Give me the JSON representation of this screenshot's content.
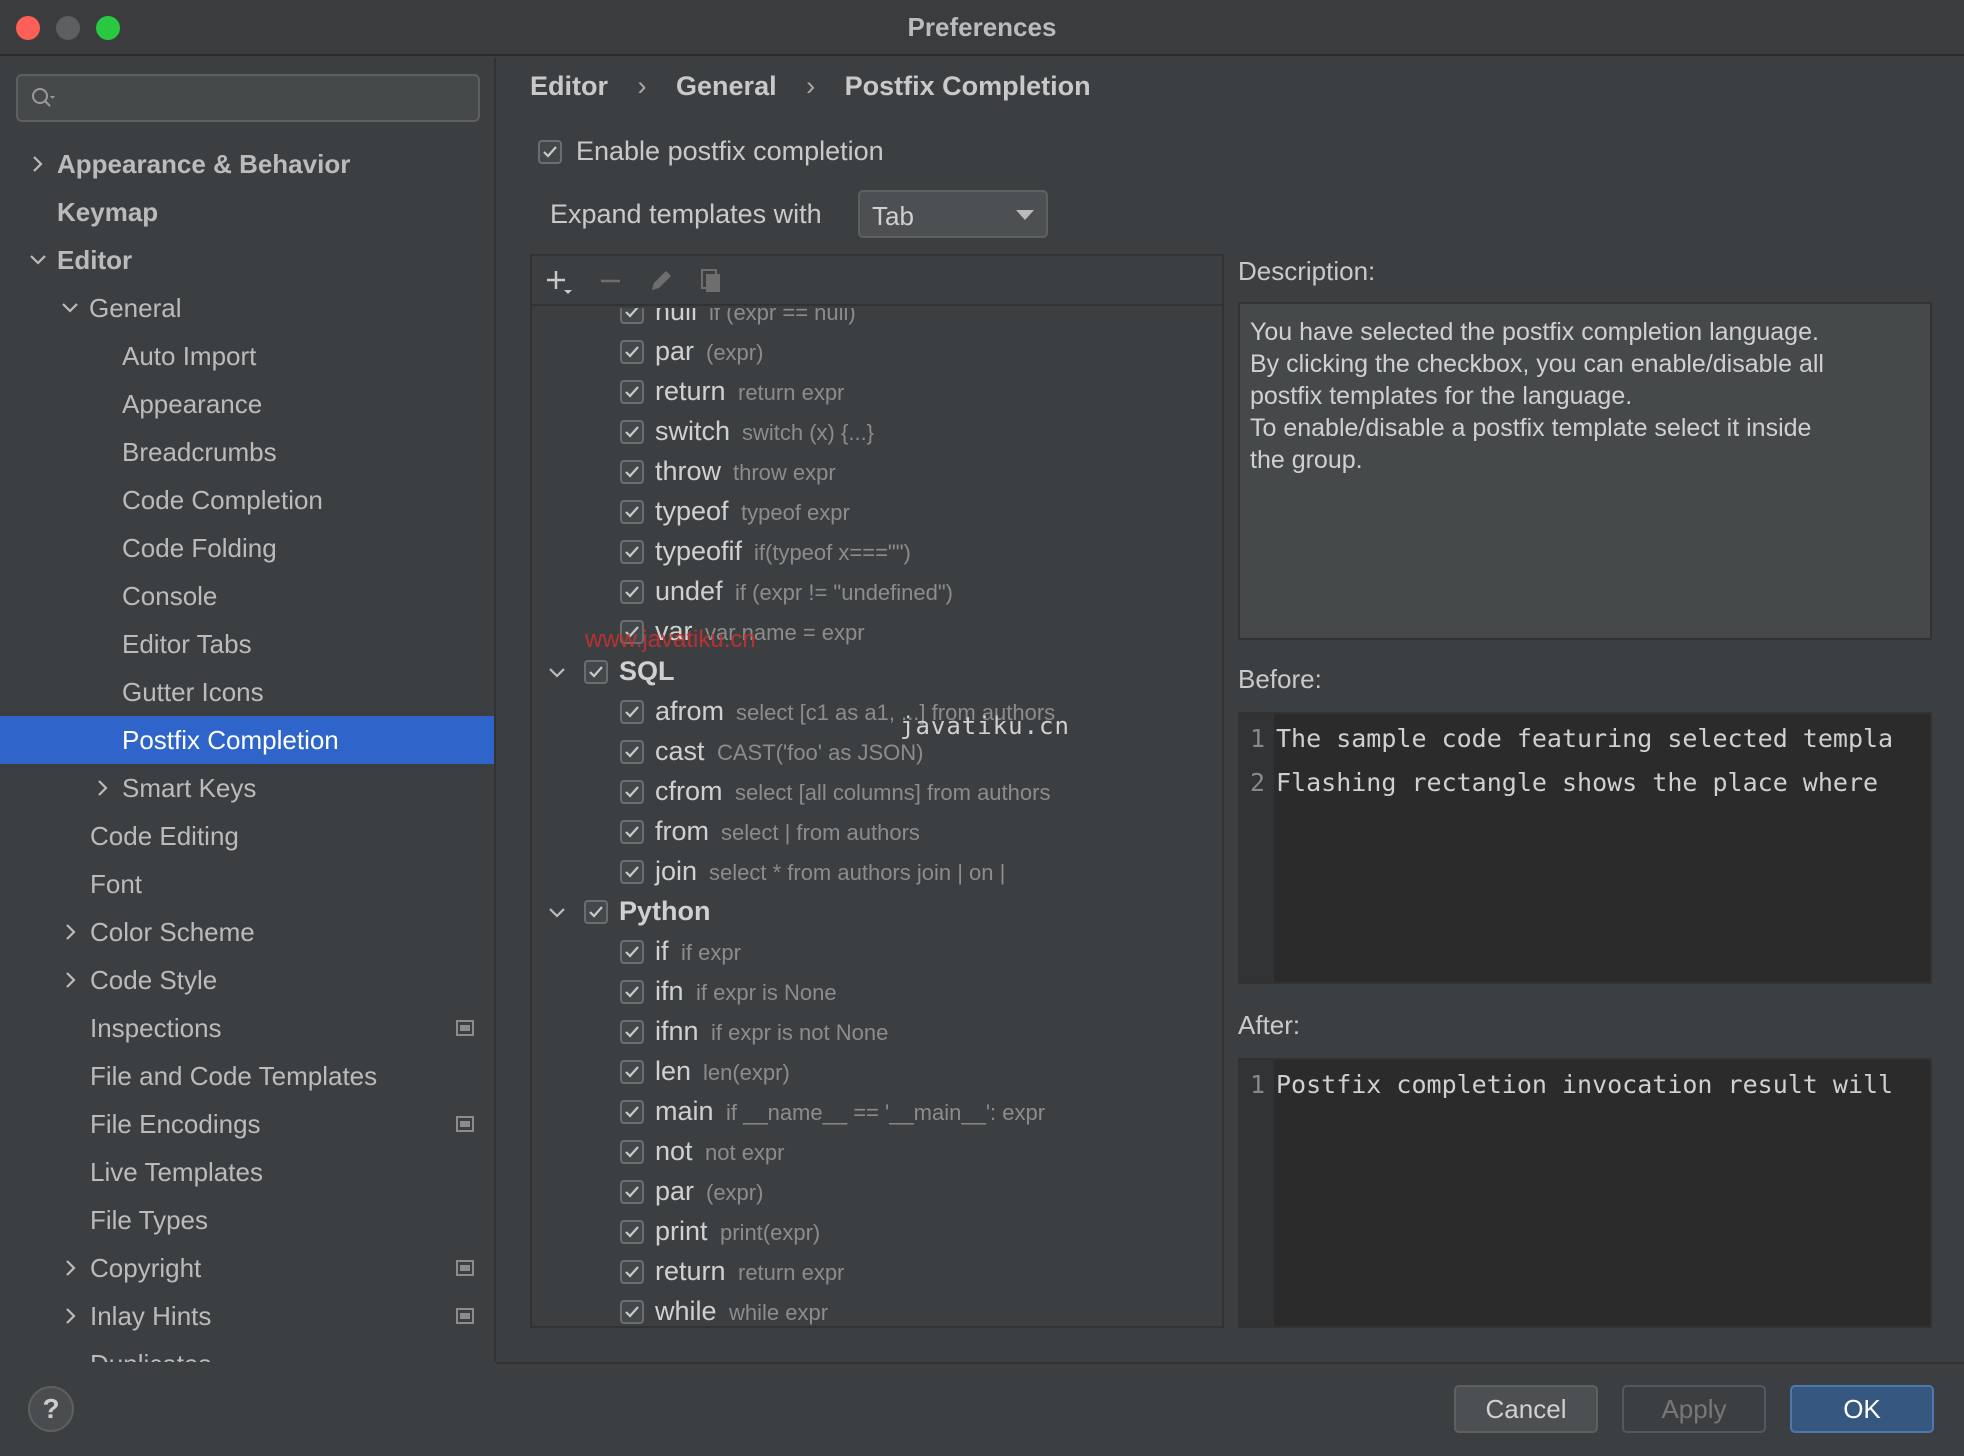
{
  "window": {
    "title": "Preferences"
  },
  "sidebar": {
    "search_placeholder": "",
    "items": [
      {
        "label": "Appearance & Behavior",
        "chevron": "right"
      },
      {
        "label": "Keymap",
        "chevron": "none"
      },
      {
        "label": "Editor",
        "chevron": "down"
      },
      {
        "label": "General",
        "chevron": "down"
      },
      {
        "label": "Auto Import",
        "chevron": "none"
      },
      {
        "label": "Appearance",
        "chevron": "none"
      },
      {
        "label": "Breadcrumbs",
        "chevron": "none"
      },
      {
        "label": "Code Completion",
        "chevron": "none"
      },
      {
        "label": "Code Folding",
        "chevron": "none"
      },
      {
        "label": "Console",
        "chevron": "none"
      },
      {
        "label": "Editor Tabs",
        "chevron": "none"
      },
      {
        "label": "Gutter Icons",
        "chevron": "none"
      },
      {
        "label": "Postfix Completion",
        "chevron": "none",
        "selected": true
      },
      {
        "label": "Smart Keys",
        "chevron": "right"
      },
      {
        "label": "Code Editing",
        "chevron": "none"
      },
      {
        "label": "Font",
        "chevron": "none"
      },
      {
        "label": "Color Scheme",
        "chevron": "right"
      },
      {
        "label": "Code Style",
        "chevron": "right"
      },
      {
        "label": "Inspections",
        "chevron": "none",
        "badge": true
      },
      {
        "label": "File and Code Templates",
        "chevron": "none"
      },
      {
        "label": "File Encodings",
        "chevron": "none",
        "badge": true
      },
      {
        "label": "Live Templates",
        "chevron": "none"
      },
      {
        "label": "File Types",
        "chevron": "none"
      },
      {
        "label": "Copyright",
        "chevron": "right",
        "badge": true
      },
      {
        "label": "Inlay Hints",
        "chevron": "right",
        "badge": true
      },
      {
        "label": "Duplicates",
        "chevron": "none"
      }
    ]
  },
  "breadcrumb": [
    "Editor",
    "General",
    "Postfix Completion"
  ],
  "enable_postfix": {
    "label": "Enable postfix completion",
    "checked": true
  },
  "expand_with": {
    "label": "Expand templates with",
    "value": "Tab"
  },
  "templates": [
    {
      "name": "null",
      "desc": "if (expr == null)",
      "group": false
    },
    {
      "name": "par",
      "desc": "(expr)",
      "group": false
    },
    {
      "name": "return",
      "desc": "return expr",
      "group": false
    },
    {
      "name": "switch",
      "desc": "switch (x) {...}",
      "group": false
    },
    {
      "name": "throw",
      "desc": "throw expr",
      "group": false
    },
    {
      "name": "typeof",
      "desc": "typeof expr",
      "group": false
    },
    {
      "name": "typeofif",
      "desc": "if(typeof x===\"\")",
      "group": false
    },
    {
      "name": "undef",
      "desc": "if (expr != \"undefined\")",
      "group": false
    },
    {
      "name": "var",
      "desc": "var name = expr",
      "group": false
    },
    {
      "name": "SQL",
      "desc": "",
      "group": true
    },
    {
      "name": "afrom",
      "desc": "select [c1 as a1, ...] from authors",
      "group": false
    },
    {
      "name": "cast",
      "desc": "CAST('foo' as JSON)",
      "group": false
    },
    {
      "name": "cfrom",
      "desc": "select [all columns] from authors",
      "group": false
    },
    {
      "name": "from",
      "desc": "select | from authors",
      "group": false
    },
    {
      "name": "join",
      "desc": "select * from authors join | on |",
      "group": false
    },
    {
      "name": "Python",
      "desc": "",
      "group": true
    },
    {
      "name": "if",
      "desc": "if expr",
      "group": false
    },
    {
      "name": "ifn",
      "desc": "if expr is None",
      "group": false
    },
    {
      "name": "ifnn",
      "desc": "if expr is not None",
      "group": false
    },
    {
      "name": "len",
      "desc": "len(expr)",
      "group": false
    },
    {
      "name": "main",
      "desc": "if __name__ == '__main__': expr",
      "group": false
    },
    {
      "name": "not",
      "desc": "not expr",
      "group": false
    },
    {
      "name": "par",
      "desc": "(expr)",
      "group": false
    },
    {
      "name": "print",
      "desc": "print(expr)",
      "group": false
    },
    {
      "name": "return",
      "desc": "return expr",
      "group": false
    },
    {
      "name": "while",
      "desc": "while expr",
      "group": false
    }
  ],
  "watermarks": {
    "red": "www.javatiku.cn",
    "mono": "javatiku.cn"
  },
  "description": {
    "label": "Description:",
    "lines": [
      "You have selected the postfix completion language.",
      "By clicking the checkbox, you can enable/disable all",
      "postfix templates for the language.",
      "To enable/disable a postfix template select it inside",
      "the group."
    ]
  },
  "before": {
    "label": "Before:",
    "lines": [
      {
        "num": "1",
        "text": "The sample code featuring selected templa"
      },
      {
        "num": "2",
        "text": " Flashing rectangle shows the place where"
      }
    ]
  },
  "after": {
    "label": "After:",
    "lines": [
      {
        "num": "1",
        "text": "Postfix completion invocation result will"
      }
    ]
  },
  "buttons": {
    "help": "?",
    "cancel": "Cancel",
    "apply": "Apply",
    "ok": "OK"
  },
  "colors": {
    "selection": "#2f65ca",
    "ok_button": "#365880",
    "background": "#3c3f41"
  }
}
